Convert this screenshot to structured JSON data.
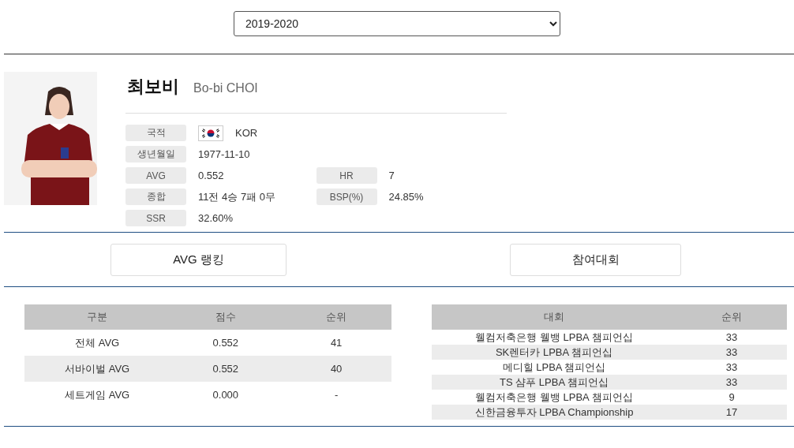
{
  "season_select": {
    "value": "2019-2020"
  },
  "player": {
    "name_ko": "최보비",
    "name_en": "Bo-bi CHOI"
  },
  "info_rows": [
    {
      "cells": [
        {
          "label": "국적",
          "value": "KOR",
          "kind": "nationality"
        }
      ]
    },
    {
      "cells": [
        {
          "label": "생년월일",
          "value": "1977-11-10",
          "kind": "text"
        }
      ]
    },
    {
      "cells": [
        {
          "label": "AVG",
          "value": "0.552",
          "kind": "text"
        },
        {
          "label": "HR",
          "value": "7",
          "kind": "text"
        }
      ]
    },
    {
      "cells": [
        {
          "label": "종합",
          "value": "11전 4승 7패 0무",
          "kind": "text"
        },
        {
          "label": "BSP(%)",
          "value": "24.85%",
          "kind": "text"
        }
      ]
    },
    {
      "cells": [
        {
          "label": "SSR",
          "value": "32.60%",
          "kind": "text"
        }
      ]
    }
  ],
  "buttons": [
    "AVG 랭킹",
    "참여대회"
  ],
  "avg_table": {
    "columns": [
      "구분",
      "점수",
      "순위"
    ],
    "rows": [
      [
        "전체 AVG",
        "0.552",
        "41"
      ],
      [
        "서바이벌 AVG",
        "0.552",
        "40"
      ],
      [
        "세트게임 AVG",
        "0.000",
        "-"
      ]
    ]
  },
  "tournament_table": {
    "columns": [
      "대회",
      "순위"
    ],
    "rows": [
      [
        "웰컴저축은행 웰뱅 LPBA 챔피언십",
        "33"
      ],
      [
        "SK렌터카 LPBA 챔피언십",
        "33"
      ],
      [
        "메디힐 LPBA 챔피언십",
        "33"
      ],
      [
        "TS 샴푸 LPBA 챔피언십",
        "33"
      ],
      [
        "웰컴저축은행 웰뱅 LPBA 챔피언십",
        "9"
      ],
      [
        "신한금융투자 LPBA Championship",
        "17"
      ]
    ]
  }
}
